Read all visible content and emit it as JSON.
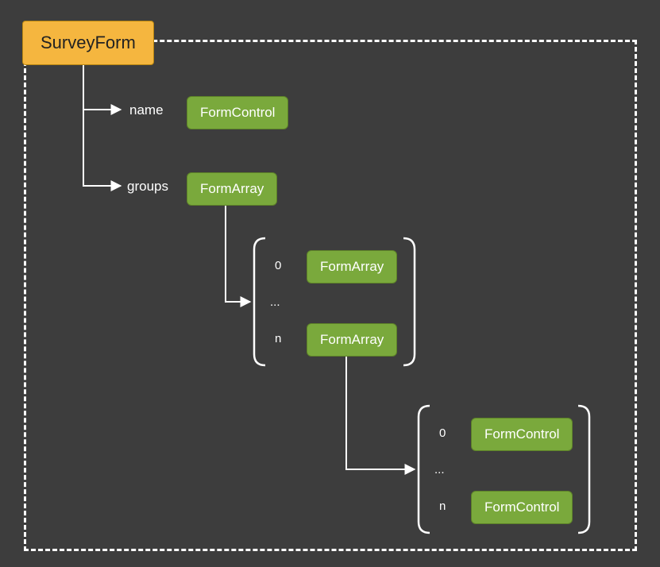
{
  "root": {
    "label": "SurveyForm"
  },
  "level1": {
    "name": {
      "field": "name",
      "type": "FormControl"
    },
    "groups": {
      "field": "groups",
      "type": "FormArray"
    }
  },
  "array1": {
    "idx0": "0",
    "ellipsis": "...",
    "idxN": "n",
    "item0_type": "FormArray",
    "itemN_type": "FormArray"
  },
  "array2": {
    "idx0": "0",
    "ellipsis": "...",
    "idxN": "n",
    "item0_type": "FormControl",
    "itemN_type": "FormControl"
  }
}
